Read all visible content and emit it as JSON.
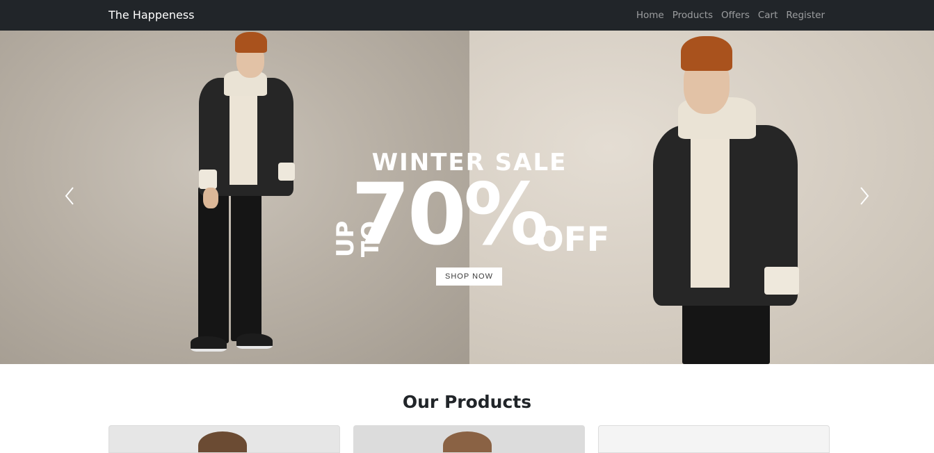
{
  "navbar": {
    "brand": "The Happeness",
    "links": [
      "Home",
      "Products",
      "Offers",
      "Cart",
      "Register"
    ]
  },
  "hero": {
    "headline": "WINTER SALE",
    "upto": "UP TO",
    "percent": "70%",
    "off": "OFF",
    "cta": "SHOP NOW",
    "prev_icon": "chevron-left-icon",
    "next_icon": "chevron-right-icon"
  },
  "products": {
    "title": "Our Products"
  },
  "colors": {
    "navbar_bg": "#212529",
    "nav_link": "rgba(255,255,255,0.55)",
    "beanie": "#a9521d",
    "jacket": "#262626"
  }
}
